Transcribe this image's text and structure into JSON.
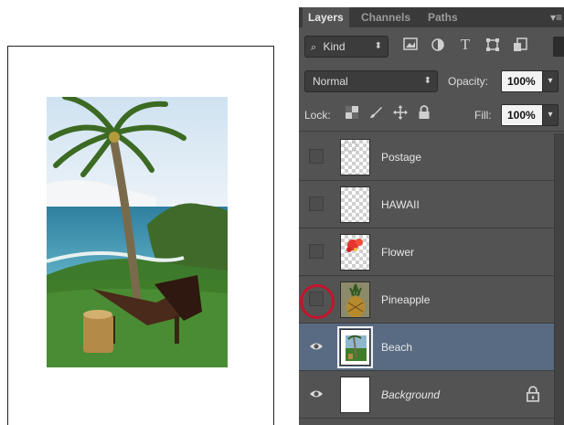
{
  "tabs": [
    {
      "label": "Layers",
      "active": true
    },
    {
      "label": "Channels",
      "active": false
    },
    {
      "label": "Paths",
      "active": false
    }
  ],
  "filter": {
    "kind_label": "Kind"
  },
  "blend": {
    "mode": "Normal",
    "opacity_label": "Opacity:",
    "opacity_value": "100%"
  },
  "lock": {
    "label": "Lock:",
    "fill_label": "Fill:",
    "fill_value": "100%"
  },
  "layers": [
    {
      "name": "Postage",
      "visible": false,
      "selected": false
    },
    {
      "name": "HAWAII",
      "visible": false,
      "selected": false
    },
    {
      "name": "Flower",
      "visible": false,
      "selected": false
    },
    {
      "name": "Pineapple",
      "visible": false,
      "selected": false,
      "highlighted": true
    },
    {
      "name": "Beach",
      "visible": true,
      "selected": true
    },
    {
      "name": "Background",
      "visible": true,
      "selected": false,
      "locked": true
    }
  ],
  "colors": {
    "panel": "#535353",
    "selected_row": "#596b82",
    "highlight_ring": "#c4142c"
  },
  "icons": [
    "search-icon",
    "image-filter-icon",
    "adjustment-filter-icon",
    "type-filter-icon",
    "shape-filter-icon",
    "smart-object-filter-icon",
    "lock-transparent-icon",
    "lock-paint-icon",
    "lock-position-icon",
    "lock-all-icon",
    "eye-icon",
    "padlock-icon",
    "panel-menu-icon"
  ]
}
